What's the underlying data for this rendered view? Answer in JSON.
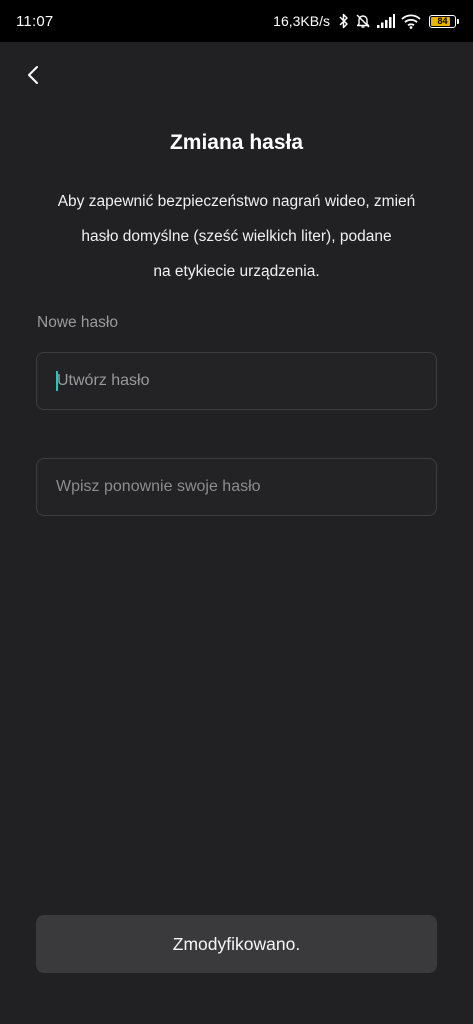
{
  "status_bar": {
    "time": "11:07",
    "network_speed": "16,3KB/s",
    "battery_level": "84",
    "icons": [
      "bluetooth-icon",
      "bell-off-icon",
      "signal-icon",
      "wifi-icon",
      "battery-icon"
    ],
    "battery_color": "#e8b400"
  },
  "header": {
    "title": "Zmiana hasła"
  },
  "description_lines": [
    "Aby zapewnić bezpieczeństwo nagrań wideo, zmień",
    "hasło domyślne (sześć wielkich liter), podane",
    "na etykiecie urządzenia."
  ],
  "form": {
    "field_label": "Nowe hasło",
    "new_password_placeholder": "Utwórz hasło",
    "confirm_password_placeholder": "Wpisz ponownie swoje hasło"
  },
  "submit_button": {
    "label": "Zmodyfikowano."
  },
  "colors": {
    "background": "#212123",
    "accent_caret": "#20c9b8",
    "button_bg": "#3a3a3c"
  }
}
